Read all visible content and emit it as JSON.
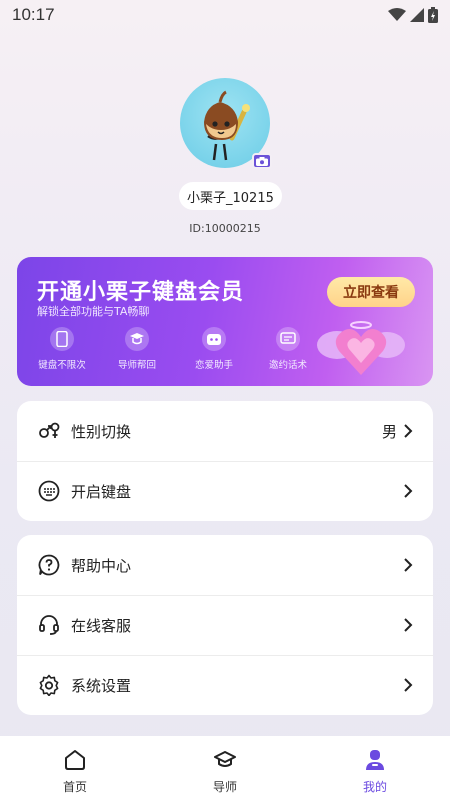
{
  "status_bar": {
    "time": "10:17"
  },
  "profile": {
    "username": "小栗子_10215",
    "user_id": "ID:10000215"
  },
  "vip": {
    "title": "开通小栗子键盘会员",
    "subtitle": "解锁全部功能与TA畅聊",
    "button": "立即查看",
    "features": [
      {
        "label": "键盘不限次",
        "icon": "phone-icon"
      },
      {
        "label": "导师帮回",
        "icon": "mentor-icon"
      },
      {
        "label": "恋爱助手",
        "icon": "robot-icon"
      },
      {
        "label": "邀约话术",
        "icon": "chat-icon"
      }
    ]
  },
  "settings_group_1": {
    "gender": {
      "label": "性别切换",
      "value": "男",
      "icon": "gender-icon"
    },
    "keyboard": {
      "label": "开启键盘",
      "icon": "keyboard-icon"
    }
  },
  "settings_group_2": {
    "help": {
      "label": "帮助中心",
      "icon": "help-icon"
    },
    "service": {
      "label": "在线客服",
      "icon": "headset-icon"
    },
    "settings": {
      "label": "系统设置",
      "icon": "gear-icon"
    }
  },
  "tabbar": {
    "home": "首页",
    "mentor": "导师",
    "mine": "我的",
    "active": "mine"
  },
  "colors": {
    "accent": "#6b4ae0",
    "vip_gradient_start": "#7c45e8",
    "vip_gradient_end": "#d995f2",
    "vip_button": "#ffd38a"
  }
}
